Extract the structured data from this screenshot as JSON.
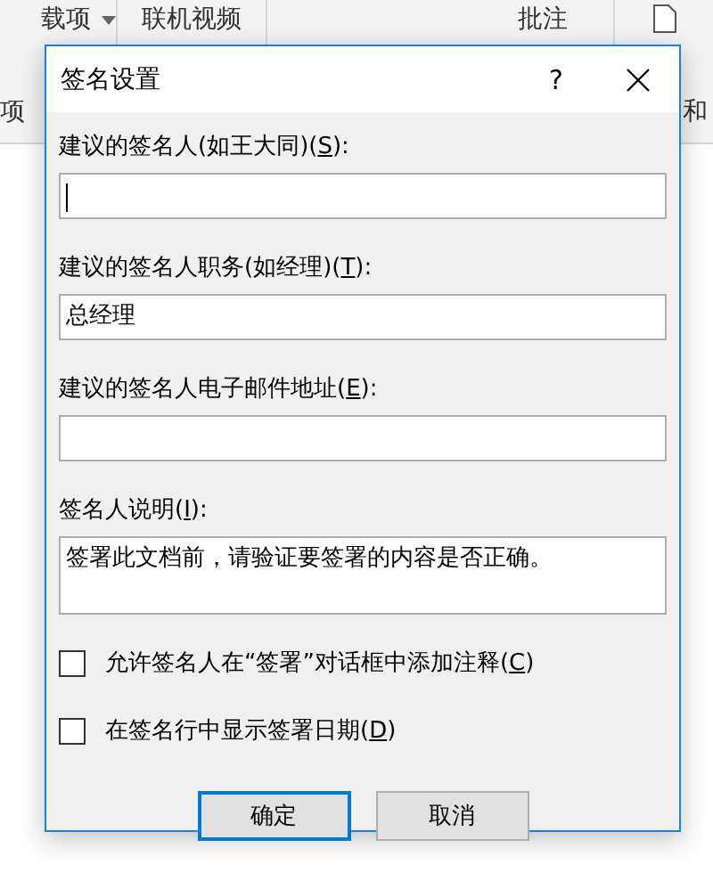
{
  "ribbon": {
    "items": [
      {
        "label": "载项",
        "kind": "dropdown"
      },
      {
        "label": "联机视频",
        "kind": "plain"
      },
      {
        "label": "批注",
        "kind": "plain"
      }
    ],
    "lower_left": "项",
    "lower_right": "和"
  },
  "dialog": {
    "title": "签名设置",
    "help": "?",
    "fields": [
      {
        "label_start": "建议的签名人(如王大同)(",
        "access_key": "S",
        "label_end": "):",
        "kind": "line",
        "focused": true
      },
      {
        "label_start": "建议的签名人职务(如经理)(",
        "access_key": "T",
        "label_end": "):",
        "value": "总经理",
        "kind": "line",
        "focused": false
      },
      {
        "label_start": "建议的签名人电子邮件地址(",
        "access_key": "E",
        "label_end": "):",
        "kind": "line",
        "focused": false
      },
      {
        "label_start": "签名人说明(",
        "access_key": "I",
        "label_end": "):",
        "value": "签署此文档前，请验证要签署的内容是否正确。",
        "kind": "area",
        "focused": false
      }
    ],
    "checkboxes": [
      {
        "label_start": "允许签名人在“签署”对话框中添加注释(",
        "access_key": "C",
        "label_end": ")",
        "checked": false
      },
      {
        "label_start": "在签名行中显示签署日期(",
        "access_key": "D",
        "label_end": ")",
        "checked": false
      }
    ],
    "buttons": [
      {
        "label": "确定",
        "default": true
      },
      {
        "label": "取消",
        "default": false
      }
    ]
  }
}
